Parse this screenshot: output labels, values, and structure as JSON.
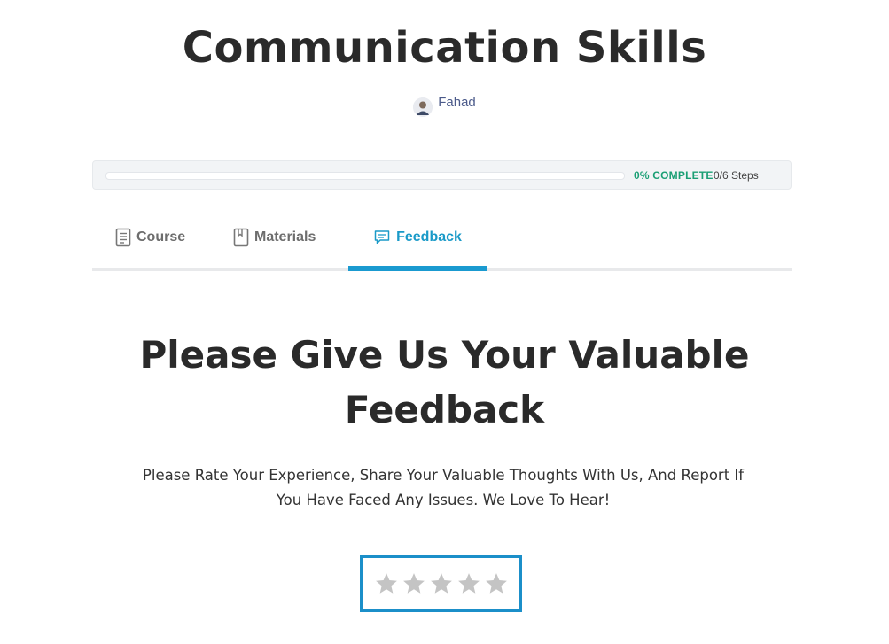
{
  "course": {
    "title": "Communication Skills",
    "author": "Fahad"
  },
  "progress": {
    "percent_label": "0% COMPLETE",
    "steps_label": "0/6 Steps",
    "fraction": 0,
    "color": "#17a583"
  },
  "tabs": [
    {
      "label": "Course",
      "icon": "document-icon",
      "active": false
    },
    {
      "label": "Materials",
      "icon": "book-icon",
      "active": false
    },
    {
      "label": "Feedback",
      "icon": "chat-icon",
      "active": true
    }
  ],
  "accent_color": "#1a9ad0",
  "feedback": {
    "heading_line1": "Please Give Us Your Valuable",
    "heading_line2": "Feedback",
    "sub_line1": "Please Rate Your Experience, Share Your Valuable Thoughts With Us, And Report If",
    "sub_line2": "You Have Faced Any Issues. We Love To Hear!",
    "rating": {
      "value": 0,
      "max": 5,
      "star_icon": "star-icon"
    }
  }
}
